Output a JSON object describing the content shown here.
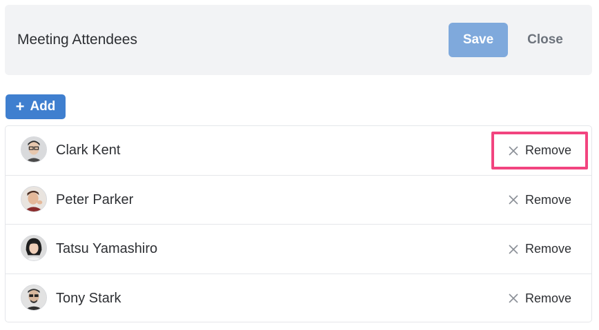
{
  "header": {
    "title": "Meeting Attendees",
    "save_label": "Save",
    "close_label": "Close"
  },
  "toolbar": {
    "add_icon": "+",
    "add_label": "Add"
  },
  "attendees": [
    {
      "name": "Clark Kent",
      "remove_label": "Remove",
      "focused": true
    },
    {
      "name": "Peter Parker",
      "remove_label": "Remove",
      "focused": false
    },
    {
      "name": "Tatsu Yamashiro",
      "remove_label": "Remove",
      "focused": false
    },
    {
      "name": "Tony Stark",
      "remove_label": "Remove",
      "focused": false
    }
  ],
  "colors": {
    "header_bg": "#f2f3f5",
    "save_bg": "#7fa9dc",
    "add_bg": "#3f7fcf",
    "focus_ring": "#f2447f"
  },
  "icons": {
    "add": "plus-icon",
    "remove": "close-icon",
    "avatar": "avatar-photo"
  }
}
